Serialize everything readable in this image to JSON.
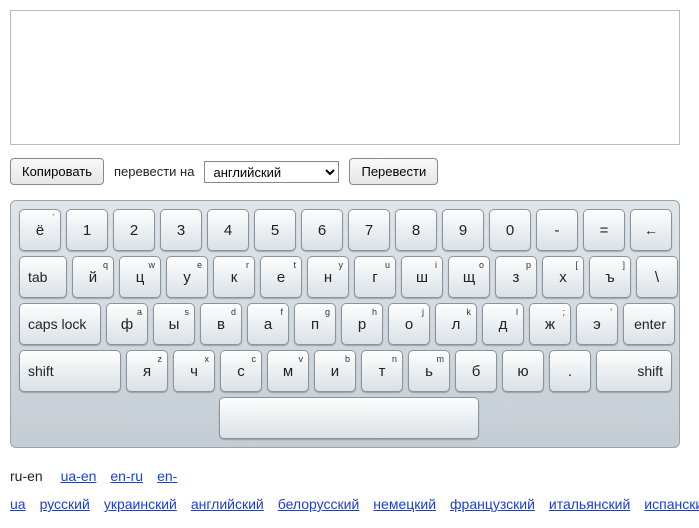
{
  "textarea_value": "",
  "textarea_placeholder": "",
  "controls": {
    "copy_label": "Копировать",
    "translate_to_label": "перевести на",
    "language_selected": "английский",
    "translate_label": "Перевести"
  },
  "keyboard": {
    "row1": [
      {
        "m": "ё",
        "s": "`"
      },
      {
        "m": "1"
      },
      {
        "m": "2"
      },
      {
        "m": "3"
      },
      {
        "m": "4"
      },
      {
        "m": "5"
      },
      {
        "m": "6"
      },
      {
        "m": "7"
      },
      {
        "m": "8"
      },
      {
        "m": "9"
      },
      {
        "m": "0"
      },
      {
        "m": "-"
      },
      {
        "m": "="
      }
    ],
    "backspace_glyph": "←",
    "tab_label": "tab",
    "row2": [
      {
        "m": "й",
        "s": "q"
      },
      {
        "m": "ц",
        "s": "w"
      },
      {
        "m": "у",
        "s": "e"
      },
      {
        "m": "к",
        "s": "r"
      },
      {
        "m": "е",
        "s": "t"
      },
      {
        "m": "н",
        "s": "y"
      },
      {
        "m": "г",
        "s": "u"
      },
      {
        "m": "ш",
        "s": "i"
      },
      {
        "m": "щ",
        "s": "o"
      },
      {
        "m": "з",
        "s": "p"
      },
      {
        "m": "х",
        "s": "["
      },
      {
        "m": "ъ",
        "s": "]"
      },
      {
        "m": "\\"
      }
    ],
    "caps_label": "caps lock",
    "row3": [
      {
        "m": "ф",
        "s": "a"
      },
      {
        "m": "ы",
        "s": "s"
      },
      {
        "m": "в",
        "s": "d"
      },
      {
        "m": "а",
        "s": "f"
      },
      {
        "m": "п",
        "s": "g"
      },
      {
        "m": "р",
        "s": "h"
      },
      {
        "m": "о",
        "s": "j"
      },
      {
        "m": "л",
        "s": "k"
      },
      {
        "m": "д",
        "s": "l"
      },
      {
        "m": "ж",
        "s": ";"
      },
      {
        "m": "э",
        "s": "'"
      }
    ],
    "enter_label": "enter",
    "shift_label": "shift",
    "row4": [
      {
        "m": "я",
        "s": "z"
      },
      {
        "m": "ч",
        "s": "x"
      },
      {
        "m": "с",
        "s": "c"
      },
      {
        "m": "м",
        "s": "v"
      },
      {
        "m": "и",
        "s": "b"
      },
      {
        "m": "т",
        "s": "n"
      },
      {
        "m": "ь",
        "s": "m"
      },
      {
        "m": "б",
        ",": ","
      },
      {
        "m": "ю"
      },
      {
        "m": "."
      }
    ]
  },
  "links": {
    "current": "ru-en",
    "items": [
      "ua-en",
      "en-ru",
      "en-ua",
      "русский",
      "украинский",
      "английский",
      "белорусский",
      "немецкий",
      "французский",
      "итальянский",
      "испанский"
    ]
  }
}
